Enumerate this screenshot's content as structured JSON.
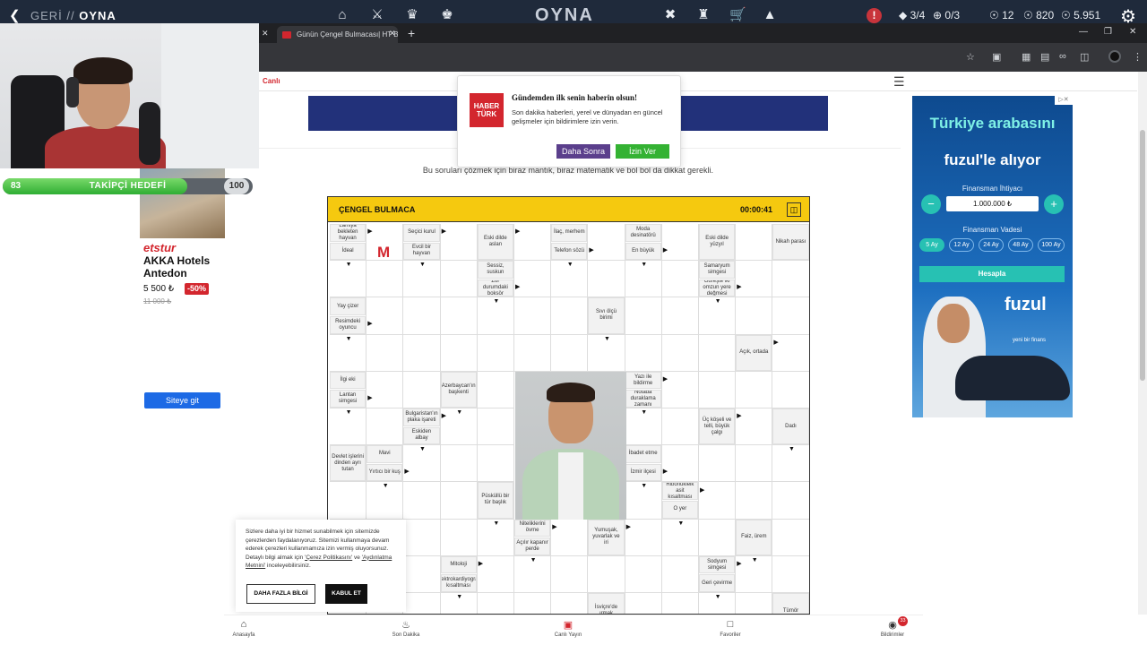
{
  "topbar": {
    "back_label": "GERİ",
    "section": "OYNA",
    "brand": "OYNA",
    "quests": "3/4",
    "plus_count": "0/3",
    "stat_v": "12",
    "stat_r": "820",
    "stat_coins": "5.951"
  },
  "browser": {
    "tab_title": "Günün Çengel Bulmacası| HT Bulmaca",
    "new_tab": "+"
  },
  "site": {
    "live_label": "Canlı",
    "intro": "Bu soruları çözmek için biraz mantık, biraz matematik ve bol bol da dikkat gerekli."
  },
  "popup": {
    "logo_line1": "HABER",
    "logo_line2": "TÜRK",
    "title": "Gündemden ilk senin haberin olsun!",
    "text": "Son dakika haberleri, yerel ve dünyadan en güncel gelişmeler için bildirimlere izin verin.",
    "later": "Daha Sonra",
    "allow": "İzin Ver"
  },
  "puzzle": {
    "title": "ÇENGEL BULMACA",
    "timer": "00:00:41",
    "letter": "M",
    "clues": [
      "Lamiya bekleten hayvan",
      "İdeal",
      "Seçici kurul",
      "Evcil bir hayvan",
      "Eski dilde aslan",
      "İlaç, merhem",
      "Telefon sözü",
      "Moda desinatörü",
      "En büyük",
      "Eski dilde yüzyıl",
      "Nikah parası",
      "Sessiz, suskun",
      "Zor durumdaki boksör",
      "Samaryum simgesi",
      "Güreşte iki omzun yere değmesi",
      "Yay çizer",
      "Resimdeki oyuncu",
      "Sıvı ölçü birimi",
      "Açık, ortada",
      "İlgi eki",
      "Lantan simgesi",
      "Azerbaycan'ın başkenti",
      "Yazı ile bildirme",
      "Notada duraklama zamanı",
      "Bulgaristan'ın plaka işareti",
      "Eskiden albay",
      "Üç köşeli ve telli, büyük çalgı",
      "Dadı",
      "Devlet işlerini dinden ayrı tutan",
      "Mavi",
      "Yırtıcı bir kuş",
      "İbadet etme",
      "İzmir ilçesi",
      "Püsküllü bir tür başlık",
      "Ribonükleik asit kısaltması",
      "O yer",
      "Niteliklerini övme",
      "Açılır kapanır perde",
      "Yumuşak, yuvarlak ve iri",
      "Faiz, ürem",
      "Mitoloji",
      "Elektrokardiyografi kısaltması",
      "Sodyum simgesi",
      "Geri çevirme",
      "İsviçre'de ırmak",
      "Tümör"
    ]
  },
  "cookie": {
    "text_before": "Sizlere daha iyi bir hizmet sunabilmek için sitemizde çerezlerden faydalanıyoruz. Sitemizi kullanmaya devam ederek çerezleri kullanmamıza izin vermiş oluyorsunuz. Detaylı bilgi almak için ",
    "link1": "'Çerez Politikasını'",
    "text_mid": " ve ",
    "link2": "'Aydınlatma Metnini'",
    "text_after": " inceleyebilirsiniz.",
    "more": "DAHA FAZLA BİLGİ",
    "accept": "KABUL ET"
  },
  "bottom_nav": [
    {
      "label": "Anasayfa",
      "icon": "home-icon"
    },
    {
      "label": "Son Dakika",
      "icon": "flame-icon"
    },
    {
      "label": "Canlı Yayın",
      "icon": "tv-icon"
    },
    {
      "label": "Favoriler",
      "icon": "bookmark-icon"
    },
    {
      "label": "Bildirimler",
      "icon": "bell-icon",
      "badge": "33"
    }
  ],
  "ad_right": {
    "headline_1": "Türkiye arabasını",
    "headline_2": "fuzul'le alıyor",
    "finance_need": "Finansman İhtiyacı",
    "amount": "1.000.000 ₺",
    "finance_term": "Finansman Vadesi",
    "terms": [
      "5 Ay",
      "12 Ay",
      "24 Ay",
      "48 Ay",
      "100 Ay"
    ],
    "calc": "Hesapla",
    "logo": "fuzul",
    "slogan": "yeni bir finans"
  },
  "follower_goal": {
    "current": "83",
    "label": "TAKİPÇİ HEDEFİ",
    "goal": "100",
    "progress": 0.83
  },
  "ad_left": {
    "brand": "etstur",
    "hotel": "AKKA Hotels Antedon",
    "price": "5 500 ₺",
    "discount": "-50%",
    "old_price": "11 000 ₺",
    "cta": "Siteye git"
  },
  "colors": {
    "accent_red": "#d3262e",
    "puzzle_yellow": "#f5c90f",
    "topbar": "#1f2a3b",
    "teal": "#27c1b3"
  }
}
